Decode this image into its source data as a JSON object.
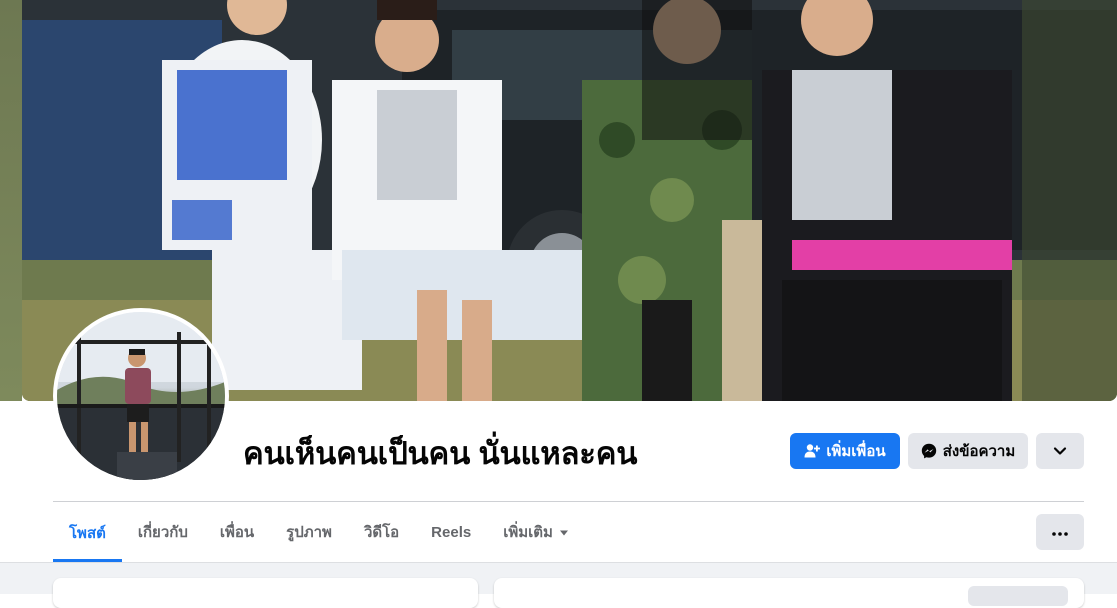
{
  "profile": {
    "name": "คนเห็นคนเป็นคน นั่นแหละคน"
  },
  "actions": {
    "add_friend_label": "เพิ่มเพื่อน",
    "message_label": "ส่งข้อความ"
  },
  "tabs": [
    {
      "label": "โพสต์",
      "active": true
    },
    {
      "label": "เกี่ยวกับ",
      "active": false
    },
    {
      "label": "เพื่อน",
      "active": false
    },
    {
      "label": "รูปภาพ",
      "active": false
    },
    {
      "label": "วิดีโอ",
      "active": false
    },
    {
      "label": "Reels",
      "active": false
    },
    {
      "label": "เพิ่มเติม",
      "active": false
    }
  ],
  "colors": {
    "accent": "#1877f2",
    "secondary_button": "#e4e6eb",
    "muted_text": "#65676b"
  },
  "icons": {
    "add_friend": "person-plus-icon",
    "message": "messenger-icon",
    "more_actions": "chevron-down-icon",
    "tab_more": "caret-down-icon",
    "options": "ellipsis-icon"
  }
}
